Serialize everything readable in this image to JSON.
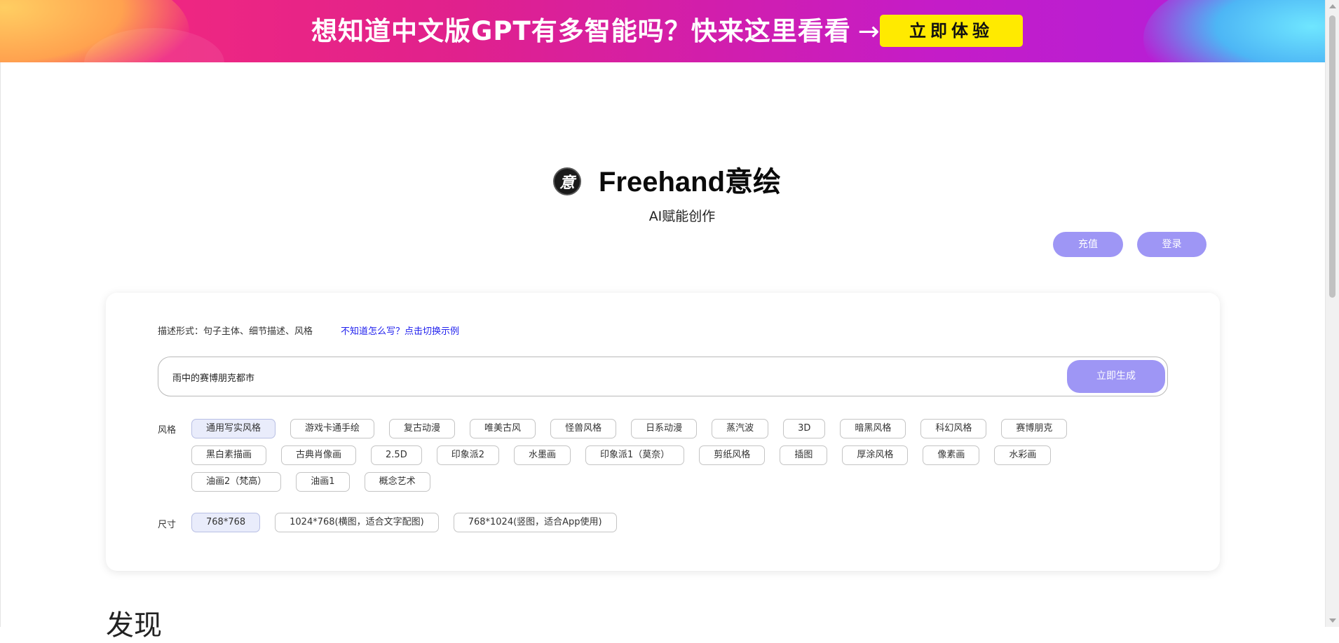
{
  "banner": {
    "slogan": "想知道中文版GPT有多智能吗？快来这里看看",
    "arrow": "→",
    "cta": "立即体验"
  },
  "header": {
    "logo_glyph": "意",
    "brand": "Freehand意绘",
    "tagline": "AI赋能创作",
    "recharge": "充值",
    "login": "登录"
  },
  "panel": {
    "hint": "描述形式：句子主体、细节描述、风格",
    "hint_link": "不知道怎么写？点击切换示例",
    "prompt_value": "雨中的赛博朋克都市",
    "generate": "立即生成",
    "style_label": "风格",
    "styles": [
      "通用写实风格",
      "游戏卡通手绘",
      "复古动漫",
      "唯美古风",
      "怪兽风格",
      "日系动漫",
      "蒸汽波",
      "3D",
      "暗黑风格",
      "科幻风格",
      "赛博朋克",
      "黑白素描画",
      "古典肖像画",
      "2.5D",
      "印象派2",
      "水墨画",
      "印象派1（莫奈）",
      "剪纸风格",
      "插图",
      "厚涂风格",
      "像素画",
      "水彩画",
      "油画2（梵高）",
      "油画1",
      "概念艺术"
    ],
    "selected_style": "通用写实风格",
    "size_label": "尺寸",
    "sizes": [
      "768*768",
      "1024*768(横图，适合文字配图)",
      "768*1024(竖图，适合App使用)"
    ],
    "selected_size": "768*768"
  },
  "discover": {
    "title": "发现"
  },
  "colors": {
    "accent": "#9e96f5",
    "cta_yellow": "#ffea00",
    "link_blue": "#2222ee",
    "selected_tag": "#e9ecfb"
  }
}
